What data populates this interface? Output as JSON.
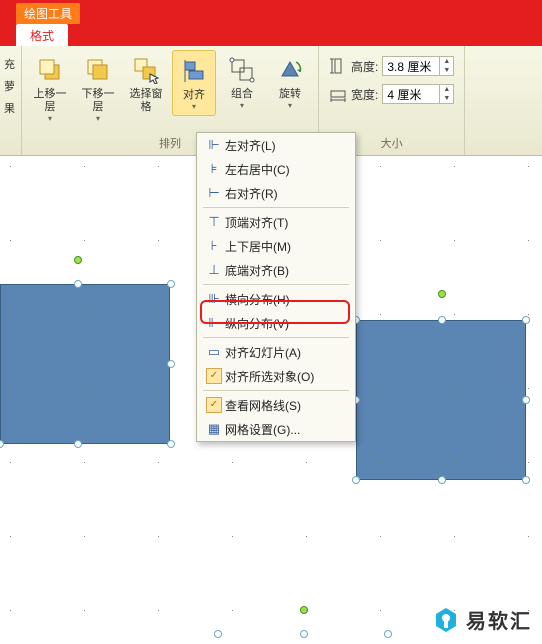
{
  "title_tag": "绘图工具",
  "tab": "格式",
  "truncated_left": [
    "充",
    "萝",
    "果"
  ],
  "ribbon": {
    "arrange": {
      "bring_forward": "上移一层",
      "send_backward": "下移一层",
      "selection_pane": "选择窗格",
      "align": "对齐",
      "group": "组合",
      "rotate": "旋转",
      "label": "排列"
    },
    "size": {
      "height_label": "高度:",
      "height_value": "3.8 厘米",
      "width_label": "宽度:",
      "width_value": "4 厘米",
      "label": "大小"
    }
  },
  "dropdown": [
    {
      "icon": "⊩",
      "label": "左对齐(L)"
    },
    {
      "icon": "⊧",
      "label": "左右居中(C)"
    },
    {
      "icon": "⊢",
      "label": "右对齐(R)"
    },
    {
      "sep": true
    },
    {
      "icon": "⊤",
      "label": "顶端对齐(T)"
    },
    {
      "icon": "⊦",
      "label": "上下居中(M)"
    },
    {
      "icon": "⊥",
      "label": "底端对齐(B)"
    },
    {
      "sep": true
    },
    {
      "icon": "⊪",
      "label": "横向分布(H)"
    },
    {
      "icon": "⊩",
      "label": "纵向分布(V)"
    },
    {
      "sep": true
    },
    {
      "icon": "▭",
      "label": "对齐幻灯片(A)"
    },
    {
      "check": true,
      "label": "对齐所选对象(O)"
    },
    {
      "sep": true
    },
    {
      "check": true,
      "label": "查看网格线(S)"
    },
    {
      "icon": "▦",
      "label": "网格设置(G)..."
    }
  ],
  "logo_text": "易软汇"
}
